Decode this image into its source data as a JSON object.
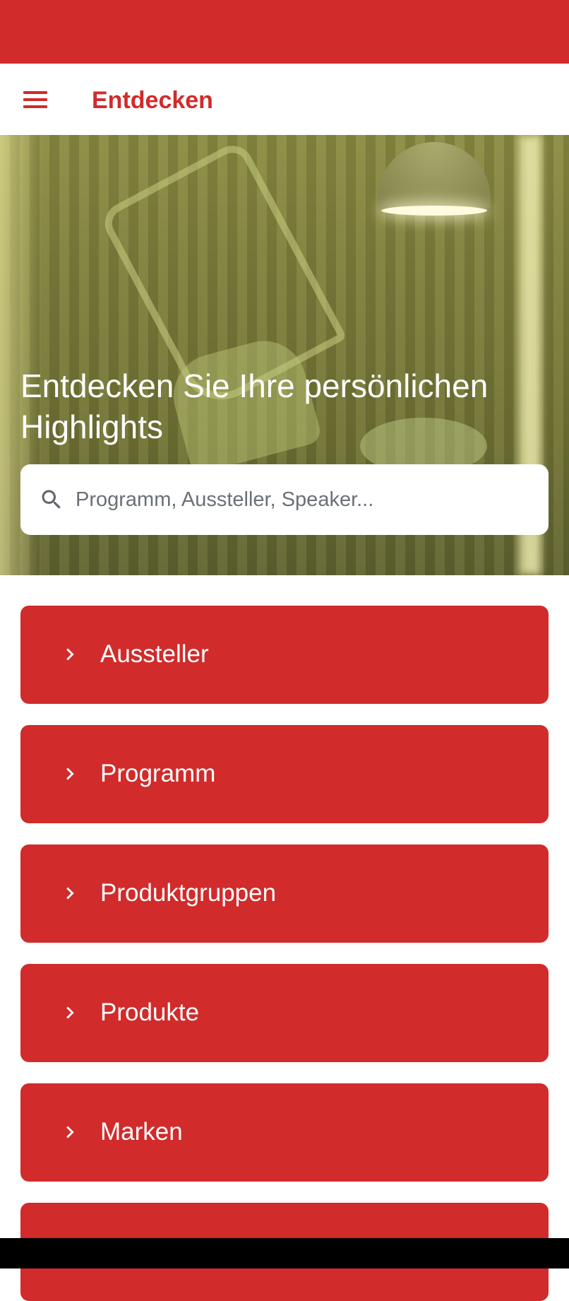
{
  "app_bar": {
    "title": "Entdecken",
    "accent_color": "#d12b2b"
  },
  "hero": {
    "headline": "Entdecken Sie Ihre persönlichen Highlights",
    "search_placeholder": "Programm, Aussteller, Speaker..."
  },
  "nav_items": [
    {
      "label": "Aussteller",
      "icon": "chevron-right-icon"
    },
    {
      "label": "Programm",
      "icon": "chevron-right-icon"
    },
    {
      "label": "Produktgruppen",
      "icon": "chevron-right-icon"
    },
    {
      "label": "Produkte",
      "icon": "chevron-right-icon"
    },
    {
      "label": "Marken",
      "icon": "chevron-right-icon"
    },
    {
      "label": "",
      "icon": ""
    }
  ]
}
